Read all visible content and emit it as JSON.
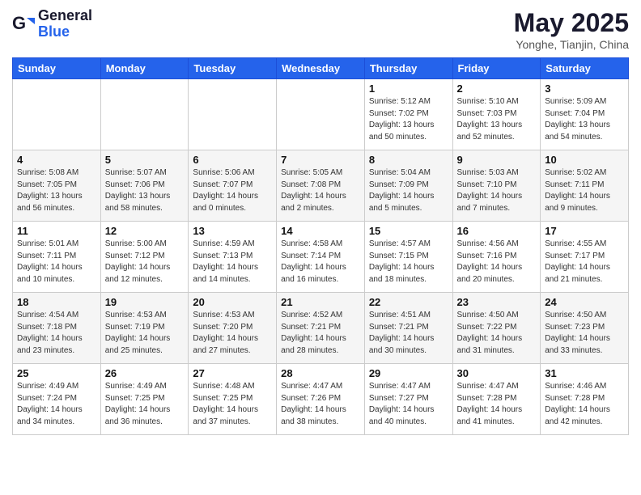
{
  "header": {
    "logo_general": "General",
    "logo_blue": "Blue",
    "title": "May 2025",
    "subtitle": "Yonghe, Tianjin, China"
  },
  "days_of_week": [
    "Sunday",
    "Monday",
    "Tuesday",
    "Wednesday",
    "Thursday",
    "Friday",
    "Saturday"
  ],
  "weeks": [
    [
      {
        "day": "",
        "sunrise": "",
        "sunset": "",
        "daylight": ""
      },
      {
        "day": "",
        "sunrise": "",
        "sunset": "",
        "daylight": ""
      },
      {
        "day": "",
        "sunrise": "",
        "sunset": "",
        "daylight": ""
      },
      {
        "day": "",
        "sunrise": "",
        "sunset": "",
        "daylight": ""
      },
      {
        "day": "1",
        "sunrise": "Sunrise: 5:12 AM",
        "sunset": "Sunset: 7:02 PM",
        "daylight": "Daylight: 13 hours and 50 minutes."
      },
      {
        "day": "2",
        "sunrise": "Sunrise: 5:10 AM",
        "sunset": "Sunset: 7:03 PM",
        "daylight": "Daylight: 13 hours and 52 minutes."
      },
      {
        "day": "3",
        "sunrise": "Sunrise: 5:09 AM",
        "sunset": "Sunset: 7:04 PM",
        "daylight": "Daylight: 13 hours and 54 minutes."
      }
    ],
    [
      {
        "day": "4",
        "sunrise": "Sunrise: 5:08 AM",
        "sunset": "Sunset: 7:05 PM",
        "daylight": "Daylight: 13 hours and 56 minutes."
      },
      {
        "day": "5",
        "sunrise": "Sunrise: 5:07 AM",
        "sunset": "Sunset: 7:06 PM",
        "daylight": "Daylight: 13 hours and 58 minutes."
      },
      {
        "day": "6",
        "sunrise": "Sunrise: 5:06 AM",
        "sunset": "Sunset: 7:07 PM",
        "daylight": "Daylight: 14 hours and 0 minutes."
      },
      {
        "day": "7",
        "sunrise": "Sunrise: 5:05 AM",
        "sunset": "Sunset: 7:08 PM",
        "daylight": "Daylight: 14 hours and 2 minutes."
      },
      {
        "day": "8",
        "sunrise": "Sunrise: 5:04 AM",
        "sunset": "Sunset: 7:09 PM",
        "daylight": "Daylight: 14 hours and 5 minutes."
      },
      {
        "day": "9",
        "sunrise": "Sunrise: 5:03 AM",
        "sunset": "Sunset: 7:10 PM",
        "daylight": "Daylight: 14 hours and 7 minutes."
      },
      {
        "day": "10",
        "sunrise": "Sunrise: 5:02 AM",
        "sunset": "Sunset: 7:11 PM",
        "daylight": "Daylight: 14 hours and 9 minutes."
      }
    ],
    [
      {
        "day": "11",
        "sunrise": "Sunrise: 5:01 AM",
        "sunset": "Sunset: 7:11 PM",
        "daylight": "Daylight: 14 hours and 10 minutes."
      },
      {
        "day": "12",
        "sunrise": "Sunrise: 5:00 AM",
        "sunset": "Sunset: 7:12 PM",
        "daylight": "Daylight: 14 hours and 12 minutes."
      },
      {
        "day": "13",
        "sunrise": "Sunrise: 4:59 AM",
        "sunset": "Sunset: 7:13 PM",
        "daylight": "Daylight: 14 hours and 14 minutes."
      },
      {
        "day": "14",
        "sunrise": "Sunrise: 4:58 AM",
        "sunset": "Sunset: 7:14 PM",
        "daylight": "Daylight: 14 hours and 16 minutes."
      },
      {
        "day": "15",
        "sunrise": "Sunrise: 4:57 AM",
        "sunset": "Sunset: 7:15 PM",
        "daylight": "Daylight: 14 hours and 18 minutes."
      },
      {
        "day": "16",
        "sunrise": "Sunrise: 4:56 AM",
        "sunset": "Sunset: 7:16 PM",
        "daylight": "Daylight: 14 hours and 20 minutes."
      },
      {
        "day": "17",
        "sunrise": "Sunrise: 4:55 AM",
        "sunset": "Sunset: 7:17 PM",
        "daylight": "Daylight: 14 hours and 21 minutes."
      }
    ],
    [
      {
        "day": "18",
        "sunrise": "Sunrise: 4:54 AM",
        "sunset": "Sunset: 7:18 PM",
        "daylight": "Daylight: 14 hours and 23 minutes."
      },
      {
        "day": "19",
        "sunrise": "Sunrise: 4:53 AM",
        "sunset": "Sunset: 7:19 PM",
        "daylight": "Daylight: 14 hours and 25 minutes."
      },
      {
        "day": "20",
        "sunrise": "Sunrise: 4:53 AM",
        "sunset": "Sunset: 7:20 PM",
        "daylight": "Daylight: 14 hours and 27 minutes."
      },
      {
        "day": "21",
        "sunrise": "Sunrise: 4:52 AM",
        "sunset": "Sunset: 7:21 PM",
        "daylight": "Daylight: 14 hours and 28 minutes."
      },
      {
        "day": "22",
        "sunrise": "Sunrise: 4:51 AM",
        "sunset": "Sunset: 7:21 PM",
        "daylight": "Daylight: 14 hours and 30 minutes."
      },
      {
        "day": "23",
        "sunrise": "Sunrise: 4:50 AM",
        "sunset": "Sunset: 7:22 PM",
        "daylight": "Daylight: 14 hours and 31 minutes."
      },
      {
        "day": "24",
        "sunrise": "Sunrise: 4:50 AM",
        "sunset": "Sunset: 7:23 PM",
        "daylight": "Daylight: 14 hours and 33 minutes."
      }
    ],
    [
      {
        "day": "25",
        "sunrise": "Sunrise: 4:49 AM",
        "sunset": "Sunset: 7:24 PM",
        "daylight": "Daylight: 14 hours and 34 minutes."
      },
      {
        "day": "26",
        "sunrise": "Sunrise: 4:49 AM",
        "sunset": "Sunset: 7:25 PM",
        "daylight": "Daylight: 14 hours and 36 minutes."
      },
      {
        "day": "27",
        "sunrise": "Sunrise: 4:48 AM",
        "sunset": "Sunset: 7:25 PM",
        "daylight": "Daylight: 14 hours and 37 minutes."
      },
      {
        "day": "28",
        "sunrise": "Sunrise: 4:47 AM",
        "sunset": "Sunset: 7:26 PM",
        "daylight": "Daylight: 14 hours and 38 minutes."
      },
      {
        "day": "29",
        "sunrise": "Sunrise: 4:47 AM",
        "sunset": "Sunset: 7:27 PM",
        "daylight": "Daylight: 14 hours and 40 minutes."
      },
      {
        "day": "30",
        "sunrise": "Sunrise: 4:47 AM",
        "sunset": "Sunset: 7:28 PM",
        "daylight": "Daylight: 14 hours and 41 minutes."
      },
      {
        "day": "31",
        "sunrise": "Sunrise: 4:46 AM",
        "sunset": "Sunset: 7:28 PM",
        "daylight": "Daylight: 14 hours and 42 minutes."
      }
    ]
  ]
}
